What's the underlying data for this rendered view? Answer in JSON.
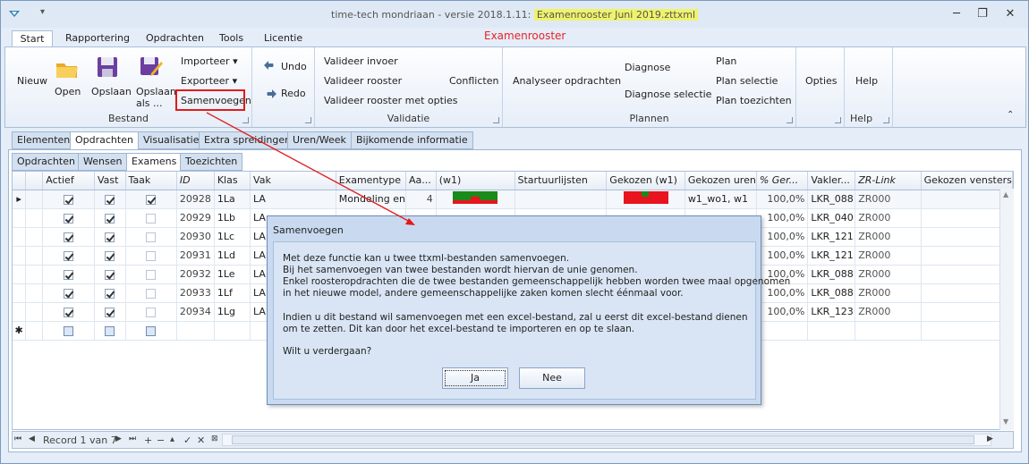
{
  "window": {
    "title_prefix": "time-tech mondriaan - versie 2018.1.11:",
    "title_file": "Examenrooster Juni 2019.zttxml",
    "minimize": "─",
    "restore": "❐",
    "close": "✕"
  },
  "ribbon_tabs": [
    "Start",
    "Rapportering",
    "Opdrachten",
    "Tools",
    "Licentie"
  ],
  "context_label": "Examenrooster",
  "ribbon": {
    "bestand": {
      "label": "Bestand",
      "nieuw": "Nieuw",
      "open": "Open",
      "opslaan": "Opslaan",
      "opslaan_als_1": "Opslaan",
      "opslaan_als_2": "als ...",
      "importeer": "Importeer",
      "exporteer": "Exporteer",
      "samenvoegen": "Samenvoegen"
    },
    "undo": "Undo",
    "redo": "Redo",
    "validatie": {
      "label": "Validatie",
      "invoer": "Valideer invoer",
      "rooster": "Valideer rooster",
      "opties": "Valideer rooster met opties",
      "conflicten": "Conflicten"
    },
    "plannen": {
      "label": "Plannen",
      "analyseer": "Analyseer opdrachten",
      "diagnose": "Diagnose",
      "diagnose_selectie": "Diagnose selectie",
      "plan": "Plan",
      "plan_selectie": "Plan selectie",
      "plan_toezichten": "Plan toezichten"
    },
    "opties": "Opties",
    "help": {
      "label": "Help",
      "btn": "Help"
    }
  },
  "doc_tabs": [
    "Elementen",
    "Opdrachten",
    "Visualisatie",
    "Extra spreidingen",
    "Uren/Week",
    "Bijkomende informatie"
  ],
  "sub_tabs": [
    "Opdrachten",
    "Wensen",
    "Examens",
    "Toezichten"
  ],
  "grid": {
    "columns": [
      "Actief",
      "Vast",
      "Taak",
      "ID",
      "Klas",
      "Vak",
      "Examentype",
      "Aa...",
      "(w1)",
      "Startuurlijsten",
      "Gekozen (w1)",
      "Gekozen uren",
      "% Ger...",
      "Vakler...",
      "ZR-Link",
      "Gekozen vensters"
    ],
    "rows": [
      {
        "actief": true,
        "vast": true,
        "taak": true,
        "id": "20928",
        "klas": "1La",
        "vak": "LA",
        "examentype": "Mondeling en",
        "aa": "4",
        "gekozen_uren": "w1_wo1, w1",
        "pct": "100,0%",
        "vakler": "LKR_088",
        "zr": "ZR000"
      },
      {
        "actief": true,
        "vast": true,
        "taak": false,
        "id": "20929",
        "klas": "1Lb",
        "vak": "LA",
        "examentype": "",
        "aa": "",
        "gekozen_uren": "",
        "pct": "100,0%",
        "vakler": "LKR_040",
        "zr": "ZR000"
      },
      {
        "actief": true,
        "vast": true,
        "taak": false,
        "id": "20930",
        "klas": "1Lc",
        "vak": "LA",
        "examentype": "",
        "aa": "",
        "gekozen_uren": "",
        "pct": "100,0%",
        "vakler": "LKR_121",
        "zr": "ZR000"
      },
      {
        "actief": true,
        "vast": true,
        "taak": false,
        "id": "20931",
        "klas": "1Ld",
        "vak": "LA",
        "examentype": "",
        "aa": "",
        "gekozen_uren": "",
        "pct": "100,0%",
        "vakler": "LKR_121",
        "zr": "ZR000"
      },
      {
        "actief": true,
        "vast": true,
        "taak": false,
        "id": "20932",
        "klas": "1Le",
        "vak": "LA",
        "examentype": "",
        "aa": "",
        "gekozen_uren": "",
        "pct": "100,0%",
        "vakler": "LKR_088",
        "zr": "ZR000"
      },
      {
        "actief": true,
        "vast": true,
        "taak": false,
        "id": "20933",
        "klas": "1Lf",
        "vak": "LA",
        "examentype": "",
        "aa": "",
        "gekozen_uren": "",
        "pct": "100,0%",
        "vakler": "LKR_088",
        "zr": "ZR000"
      },
      {
        "actief": true,
        "vast": true,
        "taak": false,
        "id": "20934",
        "klas": "1Lg",
        "vak": "LA",
        "examentype": "",
        "aa": "",
        "gekozen_uren": "",
        "pct": "100,0%",
        "vakler": "LKR_123",
        "zr": "ZR000"
      }
    ],
    "new_row_marker": "✱",
    "current_row_marker": "▸"
  },
  "navigator": {
    "record": "Record 1 van 7"
  },
  "dialog": {
    "title": "Samenvoegen",
    "lines": [
      "Met deze functie kan u twee ttxml-bestanden samenvoegen.",
      "Bij het samenvoegen van twee bestanden wordt hiervan de unie genomen.",
      "Enkel roosteropdrachten die de twee bestanden gemeenschappelijk hebben worden twee maal opgenomen",
      "in het nieuwe model, andere gemeenschappelijke zaken komen slecht éénmaal voor.",
      "Indien u dit bestand wil samenvoegen met een excel-bestand, zal u eerst dit excel-bestand dienen",
      "om te zetten. Dit kan door het excel-bestand te importeren en op te slaan.",
      "Wilt u verdergaan?"
    ],
    "ja": "Ja",
    "nee": "Nee"
  },
  "colors": {
    "accent_red": "#e21a1a",
    "green": "#1a8a1a",
    "red": "#e8141e"
  }
}
